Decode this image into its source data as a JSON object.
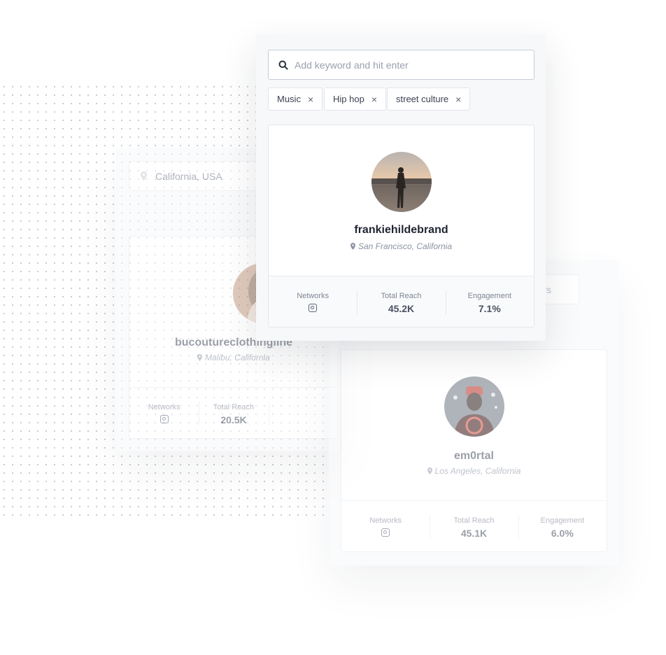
{
  "search": {
    "placeholder": "Add keyword and hit enter"
  },
  "tags": [
    {
      "label": "Music",
      "remove": "×"
    },
    {
      "label": "Hip hop",
      "remove": "×"
    },
    {
      "label": "street culture",
      "remove": "×"
    }
  ],
  "location_filter": {
    "value": "California, USA"
  },
  "filters_button": {
    "label": "Filters"
  },
  "stat_labels": {
    "networks": "Networks",
    "reach": "Total Reach",
    "engagement": "Engagement"
  },
  "profiles": [
    {
      "username": "frankiehildebrand",
      "location": "San Francisco, California",
      "reach": "45.2K",
      "engagement": "7.1%",
      "network_icon": "instagram-icon"
    },
    {
      "username": "bucoutureclothingline",
      "location": "Malibu, California",
      "reach": "20.5K",
      "network_icon": "instagram-icon"
    },
    {
      "username": "em0rtal",
      "location": "Los Angeles, California",
      "reach": "45.1K",
      "engagement": "6.0%",
      "network_icon": "instagram-icon"
    }
  ],
  "colors": {
    "text_dark": "#1f2430",
    "muted": "#8a93a3",
    "panel": "#f7f8fa",
    "border": "#e3e6ec"
  }
}
